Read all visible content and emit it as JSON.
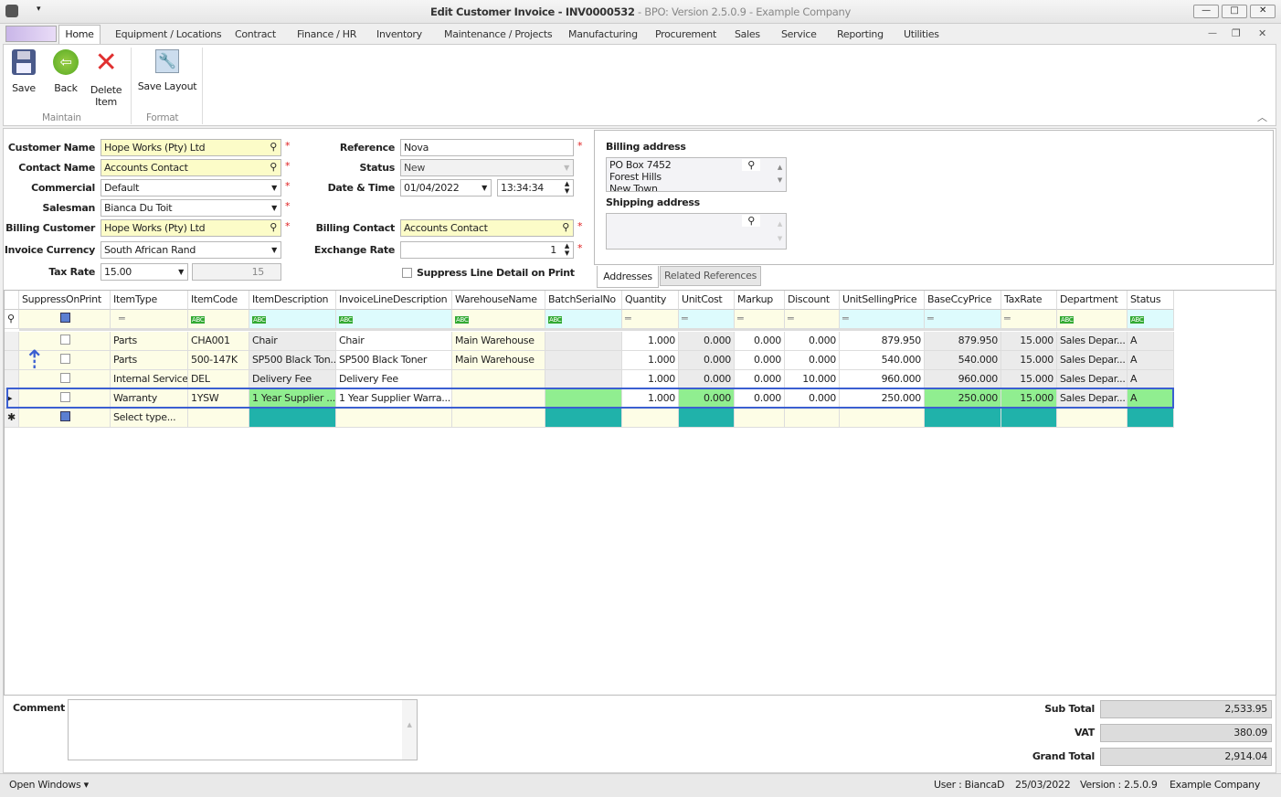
{
  "window": {
    "title": "Edit Customer Invoice - INV0000532",
    "subtitle": " - BPO: Version 2.5.0.9 - Example Company",
    "minimize": "—",
    "maximize": "□",
    "close": "✕"
  },
  "menu_tabs": [
    "Home",
    "Equipment / Locations",
    "Contract",
    "Finance / HR",
    "Inventory",
    "Maintenance / Projects",
    "Manufacturing",
    "Procurement",
    "Sales",
    "Service",
    "Reporting",
    "Utilities"
  ],
  "ribbon": {
    "save": "Save",
    "back": "Back",
    "delete_line1": "Delete",
    "delete_line2": "Item",
    "save_layout": "Save Layout",
    "group_maintain": "Maintain",
    "group_format": "Format"
  },
  "form": {
    "customer_name": {
      "label": "Customer Name",
      "value": "Hope Works (Pty) Ltd"
    },
    "contact_name": {
      "label": "Contact Name",
      "value": "Accounts Contact"
    },
    "commercial": {
      "label": "Commercial",
      "value": "Default"
    },
    "salesman": {
      "label": "Salesman",
      "value": "Bianca Du Toit"
    },
    "billing_customer": {
      "label": "Billing Customer",
      "value": "Hope Works (Pty) Ltd"
    },
    "invoice_currency": {
      "label": "Invoice Currency",
      "value": "South African Rand"
    },
    "tax_rate": {
      "label": "Tax Rate",
      "value": "15.00",
      "secondary": "15"
    },
    "reference": {
      "label": "Reference",
      "value": "Nova"
    },
    "status": {
      "label": "Status",
      "value": "New"
    },
    "date_time": {
      "label": "Date & Time",
      "date": "01/04/2022",
      "time": "13:34:34"
    },
    "billing_contact": {
      "label": "Billing Contact",
      "value": "Accounts Contact"
    },
    "exchange_rate": {
      "label": "Exchange Rate",
      "value": "1"
    },
    "suppress_line_detail": {
      "label": "Suppress Line Detail on Print",
      "checked": false
    },
    "required_marker": "*"
  },
  "addresses": {
    "billing_label": "Billing address",
    "billing_lines": [
      "PO Box 7452",
      "Forest Hills",
      "New Town"
    ],
    "shipping_label": "Shipping address",
    "tabs": [
      "Addresses",
      "Related References"
    ]
  },
  "grid": {
    "columns": [
      "SuppressOnPrint",
      "ItemType",
      "ItemCode",
      "ItemDescription",
      "InvoiceLineDescription",
      "WarehouseName",
      "BatchSerialNo",
      "Quantity",
      "UnitCost",
      "Markup",
      "Discount",
      "UnitSellingPrice",
      "BaseCcyPrice",
      "TaxRate",
      "Department",
      "Status"
    ],
    "rows": [
      [
        "",
        "Parts",
        "CHA001",
        "Chair",
        "Chair",
        "Main Warehouse",
        "",
        "1.000",
        "0.000",
        "0.000",
        "0.000",
        "879.950",
        "879.950",
        "15.000",
        "Sales Depar...",
        "A"
      ],
      [
        "",
        "Parts",
        "500-147K",
        "SP500 Black Ton...",
        "SP500 Black Toner",
        "Main Warehouse",
        "",
        "1.000",
        "0.000",
        "0.000",
        "0.000",
        "540.000",
        "540.000",
        "15.000",
        "Sales Depar...",
        "A"
      ],
      [
        "",
        "Internal Service",
        "DEL",
        "Delivery Fee",
        "Delivery Fee",
        "",
        "",
        "1.000",
        "0.000",
        "0.000",
        "10.000",
        "960.000",
        "960.000",
        "15.000",
        "Sales Depar...",
        "A"
      ],
      [
        "",
        "Warranty",
        "1YSW",
        "1 Year Supplier ...",
        "1 Year Supplier Warra...",
        "",
        "",
        "1.000",
        "0.000",
        "0.000",
        "0.000",
        "250.000",
        "250.000",
        "15.000",
        "Sales Depar...",
        "A"
      ]
    ],
    "new_row_placeholder": "Select type...",
    "selected_row": 3,
    "colors": {
      "editable": "#fdfde6",
      "readonly": "#ebebeb",
      "highlight": "#90ee90",
      "new_row": "#20b2aa",
      "selection_border": "#3b5fd1"
    }
  },
  "comment": {
    "label": "Comment",
    "value": ""
  },
  "totals": {
    "sub_total_label": "Sub Total",
    "sub_total": "2,533.95",
    "vat_label": "VAT",
    "vat": "380.09",
    "grand_total_label": "Grand Total",
    "grand_total": "2,914.04"
  },
  "statusbar": {
    "open_windows": "Open Windows ▾",
    "user": "User : BiancaD",
    "date": "25/03/2022",
    "version": "Version : 2.5.0.9",
    "company": "Example Company"
  }
}
